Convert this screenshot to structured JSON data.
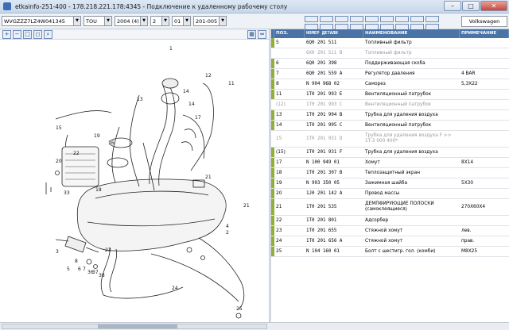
{
  "window": {
    "title": "etkainfo-251-400 - 178.218.221.178:4345 - Подключение к удаленному рабочему столу",
    "minimize": "–",
    "maximize": "□",
    "close": "✕"
  },
  "toolbar": {
    "vin": "WVGZZZ7LZ4W041345",
    "model": "TOU",
    "year": "2004 (4)",
    "main_group": "2",
    "sub_group": "01",
    "illustration": "201-005",
    "brand": "Volkswagen"
  },
  "left_tools": {
    "zoom_in": "+",
    "zoom_out": "−",
    "zoom_fit": "□",
    "zoom_area": "◻",
    "search": "⌕",
    "grid_view": "▦",
    "expand": "⇔"
  },
  "table": {
    "headers": {
      "pos": "ПОЗ.",
      "num": "НОМЕР ДЕТАЛИ",
      "name": "НАИМЕНОВАНИЕ",
      "note": "ПРИМЕЧАНИЕ"
    },
    "rows": [
      {
        "pos": "5",
        "num": "6Q0 201 511",
        "name": "Топливный фильтр",
        "note": "",
        "grey": false,
        "mark": "g",
        "h": 1
      },
      {
        "pos": "",
        "num": "6X0 201 511 B",
        "name": "Топливный фильтр",
        "note": "",
        "grey": true,
        "mark": "n",
        "h": 1
      },
      {
        "pos": "6",
        "num": "6Q0 201 398",
        "name": "Поддерживающая скоба",
        "note": "",
        "grey": false,
        "mark": "g",
        "h": 1
      },
      {
        "pos": "7",
        "num": "6Q0 201 559 A",
        "name": "Регулятор давления",
        "note": "4 BAR",
        "grey": false,
        "mark": "g",
        "h": 1
      },
      {
        "pos": "8",
        "num": "N  904 968 02",
        "name": "Саморез",
        "note": "5,3X22",
        "grey": false,
        "mark": "g",
        "h": 1
      },
      {
        "pos": "11",
        "num": "1T0 201 993 E",
        "name": "Вентиляционный патрубок",
        "note": "",
        "grey": false,
        "mark": "g",
        "h": 1
      },
      {
        "pos": "(12)",
        "num": "1T0 201 993 C",
        "name": "Вентиляционный патрубок",
        "note": "",
        "grey": true,
        "mark": "n",
        "h": 1
      },
      {
        "pos": "13",
        "num": "1T0 201 994 B",
        "name": "Трубка для удаления воздуха",
        "note": "",
        "grey": false,
        "mark": "g",
        "h": 1
      },
      {
        "pos": "14",
        "num": "1T0 201 995 C",
        "name": "Вентиляционный патрубок",
        "note": "",
        "grey": false,
        "mark": "g",
        "h": 1
      },
      {
        "pos": "15",
        "num": "1T0 201 931 D",
        "name": "Трубка для удаления воздуха F   >> 1T-3 000 400*",
        "note": "",
        "grey": true,
        "mark": "n",
        "h": 2
      },
      {
        "pos": "(15)",
        "num": "1T0 201 931 F",
        "name": "Трубка для удаления воздуха",
        "note": "",
        "grey": false,
        "mark": "g",
        "h": 1
      },
      {
        "pos": "17",
        "num": "N  100 949 01",
        "name": "Хомут",
        "note": "8X14",
        "grey": false,
        "mark": "g",
        "h": 1
      },
      {
        "pos": "18",
        "num": "1T0 201 307 B",
        "name": "Теплозащитный экран",
        "note": "",
        "grey": false,
        "mark": "g",
        "h": 1
      },
      {
        "pos": "19",
        "num": "N  903 350 05",
        "name": "Зажимная шайба",
        "note": "5X30",
        "grey": false,
        "mark": "g",
        "h": 1
      },
      {
        "pos": "20",
        "num": "1J0 201 142 A",
        "name": "Провод массы",
        "note": "",
        "grey": false,
        "mark": "g",
        "h": 1
      },
      {
        "pos": "21",
        "num": "1T0 201 535",
        "name": "ДЕМПФИРУЮЩИЕ ПОЛОСКИ (самоклеящиеся)",
        "note": "270X60X4",
        "grey": false,
        "mark": "g",
        "h": 2
      },
      {
        "pos": "22",
        "num": "1T0 201 801",
        "name": "Адсорбер",
        "note": "",
        "grey": false,
        "mark": "g",
        "h": 1
      },
      {
        "pos": "23",
        "num": "1T0 201 655",
        "name": "Стяжной хомут",
        "note": "лев.",
        "grey": false,
        "mark": "g",
        "h": 1
      },
      {
        "pos": "24",
        "num": "1T0 201 656 A",
        "name": "Стяжной хомут",
        "note": "прав.",
        "grey": false,
        "mark": "g",
        "h": 1
      },
      {
        "pos": "25",
        "num": "N  104 160 01",
        "name": "Болт с шестигр. гол. (комби)",
        "note": "M8X25",
        "grey": false,
        "mark": "g",
        "h": 1
      }
    ]
  },
  "callouts": [
    "1",
    "2",
    "3",
    "4",
    "5",
    "6",
    "7",
    "8",
    "11",
    "12",
    "13",
    "14",
    "15",
    "16",
    "17",
    "18",
    "19",
    "20",
    "21",
    "22",
    "23",
    "24",
    "25",
    "33",
    "36",
    "37",
    "38"
  ]
}
